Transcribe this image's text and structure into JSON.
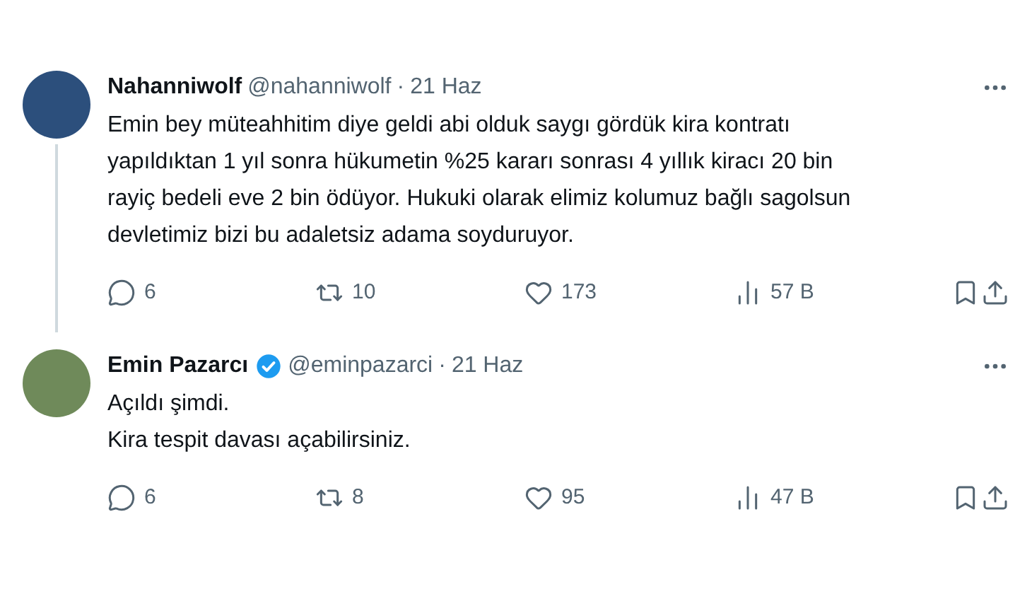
{
  "tweets": [
    {
      "name": "Nahanniwolf",
      "verified": false,
      "handle": "@nahanniwolf",
      "separator": "·",
      "date": "21 Haz",
      "thread_continues": true,
      "text_lines": [
        "Emin bey müteahhitim diye geldi abi olduk saygı gördük kira kontratı",
        "yapıldıktan 1 yıl sonra hükumetin %25 kararı sonrası 4 yıllık kiracı 20 bin",
        "rayiç bedeli eve 2 bin ödüyor. Hukuki olarak elimiz kolumuz bağlı sagolsun",
        "devletimiz bizi bu adaletsiz adama soyduruyor."
      ],
      "replies": "6",
      "retweets": "10",
      "likes": "173",
      "views": "57 B"
    },
    {
      "name": "Emin Pazarcı",
      "verified": true,
      "handle": "@eminpazarci",
      "separator": "·",
      "date": "21 Haz",
      "thread_continues": false,
      "text_lines": [
        "Açıldı şimdi.",
        "Kira tespit davası açabilirsiniz."
      ],
      "replies": "6",
      "retweets": "8",
      "likes": "95",
      "views": "47 B"
    }
  ]
}
